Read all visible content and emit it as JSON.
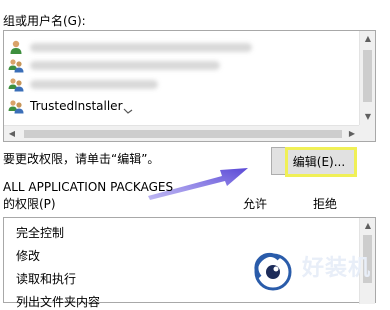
{
  "group_label": "组或用户名(G):",
  "users": [
    {
      "name": "",
      "icon": "single-user-icon"
    },
    {
      "name": "",
      "icon": "user-group-icon"
    },
    {
      "name": "",
      "icon": "user-group-icon"
    },
    {
      "name": "TrustedInstaller",
      "icon": "user-group-icon"
    }
  ],
  "change_hint": "要更改权限，请单击“编辑”。",
  "edit_button": "编辑(E)...",
  "selected_principal": "ALL APPLICATION PACKAGES",
  "permissions_label": "的权限(P)",
  "allow_label": "允许",
  "deny_label": "拒绝",
  "permissions": [
    "完全控制",
    "修改",
    "读取和执行",
    "列出文件夹内容"
  ],
  "watermark_text": "好装机",
  "colors": {
    "highlight": "#f0f056",
    "arrow": "#6b5cd6"
  }
}
